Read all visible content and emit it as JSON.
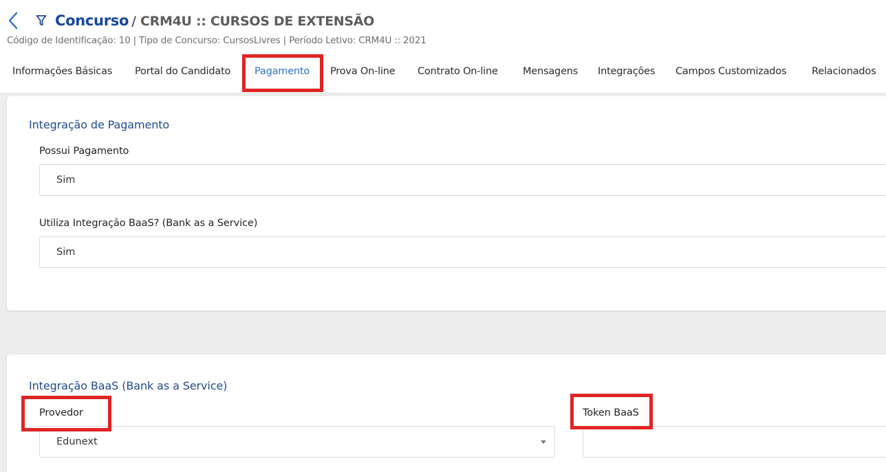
{
  "header": {
    "title": "Concurso",
    "subtitle": "/ CRM4U :: CURSOS DE EXTENSÃO",
    "info": "Código de Identificação: 10 | Tipo de Concurso: CursosLivres | Período Letivo: CRM4U :: 2021",
    "back_icon": "chevron-left-icon",
    "filter_icon": "filter-icon"
  },
  "tabs": [
    {
      "label": "Informações Básicas"
    },
    {
      "label": "Portal do Candidato"
    },
    {
      "label": "Pagamento",
      "active": true
    },
    {
      "label": "Prova On-line"
    },
    {
      "label": "Contrato On-line"
    },
    {
      "label": "Mensagens"
    },
    {
      "label": "Integrações"
    },
    {
      "label": "Campos Customizados"
    },
    {
      "label": "Relacionados"
    }
  ],
  "payment": {
    "section_title": "Integração de Pagamento",
    "has_payment_label": "Possui Pagamento",
    "has_payment_value": "Sim",
    "baas_label": "Utiliza Integração BaaS? (Bank as a Service)",
    "baas_value": "Sim"
  },
  "baas": {
    "section_title": "Integração BaaS (Bank as a Service)",
    "provider_label": "Provedor",
    "provider_value": "Edunext",
    "token_label": "Token BaaS",
    "token_value": ""
  },
  "colors": {
    "accent": "#2f6fc9",
    "title": "#17479e",
    "highlight": "#e02424"
  }
}
